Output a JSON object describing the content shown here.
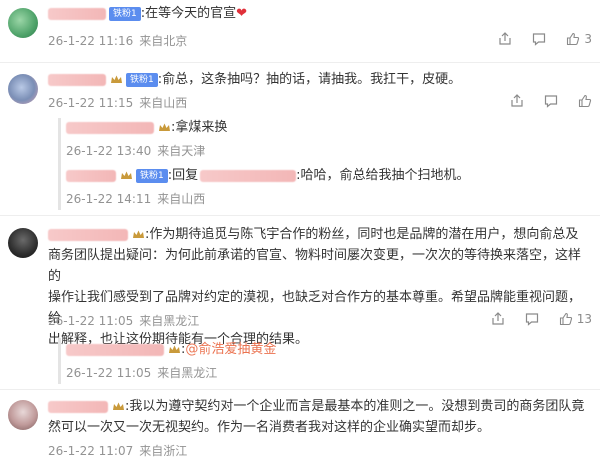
{
  "comments": [
    {
      "badge": "铁粉1",
      "text": ":在等今天的官宣",
      "heart": "❤",
      "time": "26-1-22 11:16",
      "location": "来自北京",
      "likes": "3"
    },
    {
      "badge": "铁粉1",
      "text": ":俞总，这条抽吗？抽的话，请抽我。我扛干，皮硬。",
      "time": "26-1-22 11:15",
      "location": "来自山西",
      "replies": [
        {
          "text": ":拿煤来换",
          "time": "26-1-22 13:40",
          "location": "来自天津"
        },
        {
          "badge": "铁粉1",
          "prefix": ":回复",
          "text": ":哈哈，俞总给我抽个扫地机。",
          "time": "26-1-22 14:11",
          "location": "来自山西"
        }
      ]
    },
    {
      "lines": [
        ":作为期待追觅与陈飞宇合作的粉丝，同时也是品牌的潜在用户，想向俞总及",
        "商务团队提出疑问：为何此前承诺的官宣、物料时间屡次变更，一次次的等待换来落空，这样的",
        "操作让我们感受到了品牌对约定的漠视，也缺乏对合作方的基本尊重。希望品牌能重视问题，给",
        "出解释，也让这份期待能有一个合理的结果。"
      ],
      "time": "26-1-22 11:05",
      "location": "来自黑龙江",
      "likes": "13",
      "replies": [
        {
          "text": ":",
          "mention": "@俞浩爱抽黄金",
          "time": "26-1-22 11:05",
          "location": "来自黑龙江"
        }
      ]
    },
    {
      "lines": [
        ":我以为遵守契约对一个企业而言是最基本的准则之一。没想到贵司的商务团队竟",
        "然可以一次又一次无视契约。作为一名消费者我对这样的企业确实望而却步。"
      ],
      "time": "26-1-22 11:07",
      "location": "来自浙江"
    }
  ],
  "icons": {
    "share": "share-icon",
    "comment": "comment-icon",
    "like": "like-icon"
  },
  "colors": {
    "badge": "#5b8def",
    "mention": "#eb7350",
    "meta": "#939393"
  }
}
